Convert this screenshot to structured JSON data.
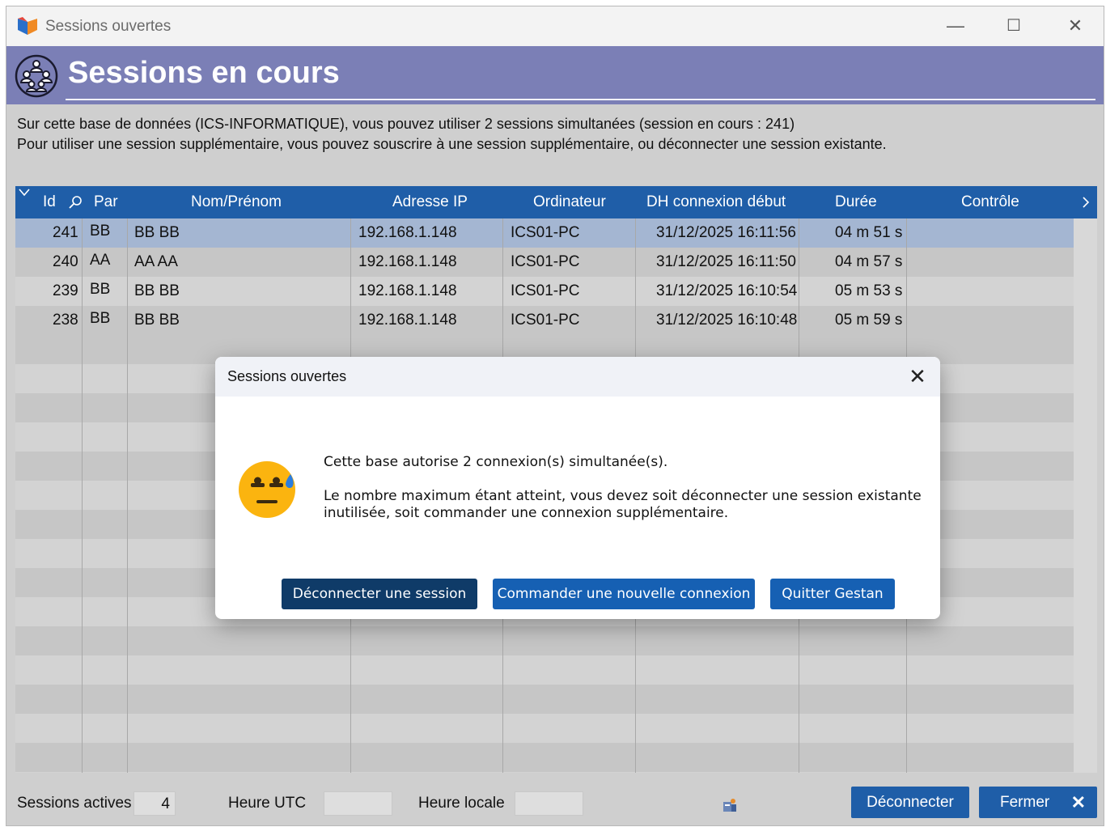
{
  "window": {
    "title": "Sessions ouvertes",
    "minimize": "—",
    "maximize": "☐",
    "close": "✕"
  },
  "header": {
    "title": "Sessions en cours"
  },
  "info": {
    "line1": "Sur cette base de données (ICS-INFORMATIQUE), vous pouvez utiliser 2 sessions simultanées (session en cours : 241)",
    "line2": "Pour utiliser une session supplémentaire, vous pouvez souscrire à une session supplémentaire, ou déconnecter une session existante."
  },
  "grid": {
    "columns": {
      "id": "Id",
      "par": "Par",
      "nom": "Nom/Prénom",
      "ip": "Adresse IP",
      "ordi": "Ordinateur",
      "dh": "DH connexion début",
      "duree": "Durée",
      "controle": "Contrôle"
    },
    "rows": [
      {
        "id": "241",
        "par": "BB",
        "nom": "BB BB",
        "ip": "192.168.1.148",
        "ordi": "ICS01-PC",
        "dh": "31/12/2025 16:11:56",
        "duree": "04 m 51 s",
        "selected": true
      },
      {
        "id": "240",
        "par": "AA",
        "nom": "AA AA",
        "ip": "192.168.1.148",
        "ordi": "ICS01-PC",
        "dh": "31/12/2025 16:11:50",
        "duree": "04 m 57 s"
      },
      {
        "id": "239",
        "par": "BB",
        "nom": "BB BB",
        "ip": "192.168.1.148",
        "ordi": "ICS01-PC",
        "dh": "31/12/2025 16:10:54",
        "duree": "05 m 53 s"
      },
      {
        "id": "238",
        "par": "BB",
        "nom": "BB BB",
        "ip": "192.168.1.148",
        "ordi": "ICS01-PC",
        "dh": "31/12/2025 16:10:48",
        "duree": "05 m 59 s"
      }
    ]
  },
  "status": {
    "sessions_label": "Sessions actives",
    "sessions_value": "4",
    "utc_label": "Heure UTC",
    "local_label": "Heure locale",
    "disconnect": "Déconnecter",
    "close": "Fermer",
    "close_icon": "✕"
  },
  "dialog": {
    "title": "Sessions ouvertes",
    "close": "✕",
    "msg1": "Cette base autorise 2 connexion(s) simultanée(s).",
    "msg2a": "Le nombre maximum étant atteint, vous devez soit déconnecter une session existante",
    "msg2b": "inutilisée, soit commander une connexion supplémentaire.",
    "btn_disconnect": "Déconnecter une session",
    "btn_order": "Commander une nouvelle connexion",
    "btn_quit": "Quitter Gestan"
  },
  "colors": {
    "header_band": "#7b7fb6",
    "grid_header": "#1f5ea8",
    "selected_row": "#a4b6d2",
    "dialog_primary": "#0f3b68",
    "dialog_secondary": "#1660b3"
  }
}
